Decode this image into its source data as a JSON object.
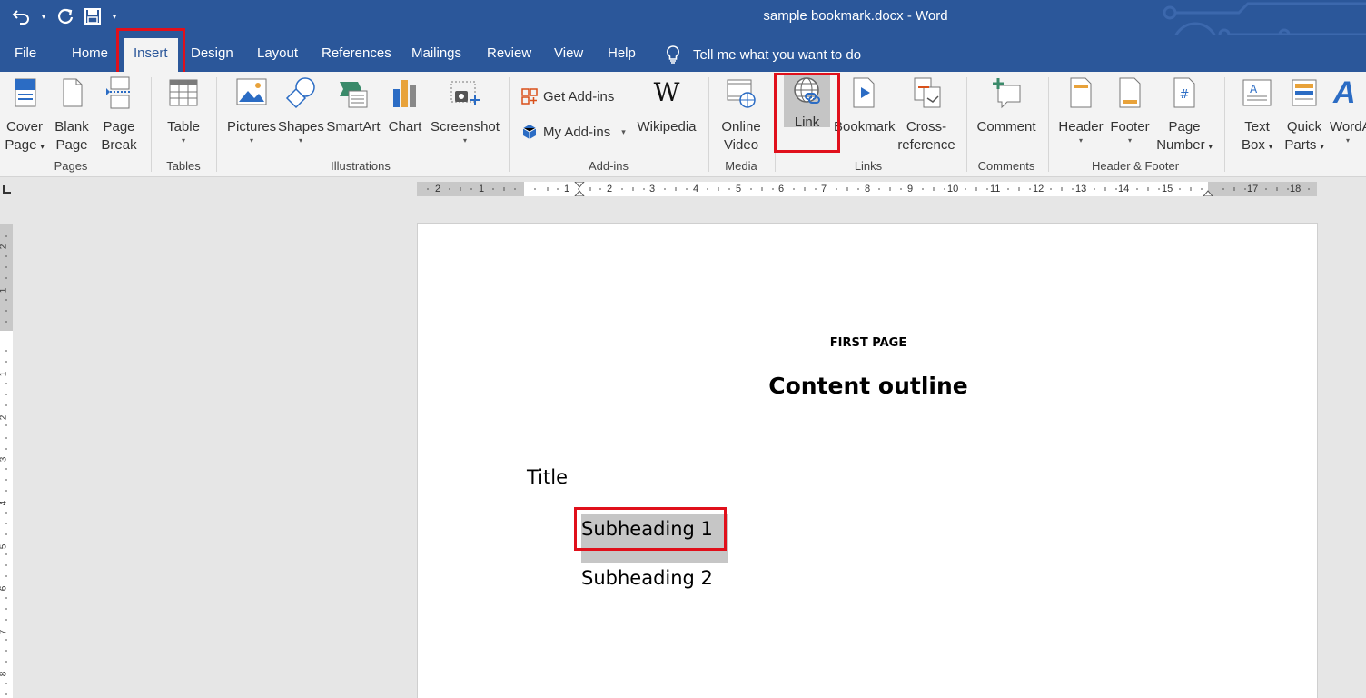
{
  "titlebar": {
    "document_title": "sample bookmark.docx  -  Word",
    "qat": {
      "undo_icon": "undo-icon",
      "redo_icon": "redo-icon",
      "save_icon": "save-icon",
      "customize_icon": "customize-qat-icon"
    }
  },
  "tabs": [
    {
      "label": "File"
    },
    {
      "label": "Home"
    },
    {
      "label": "Insert"
    },
    {
      "label": "Design"
    },
    {
      "label": "Layout"
    },
    {
      "label": "References"
    },
    {
      "label": "Mailings"
    },
    {
      "label": "Review"
    },
    {
      "label": "View"
    },
    {
      "label": "Help"
    }
  ],
  "tell_me": "Tell me what you want to do",
  "ribbon": {
    "pages": {
      "label": "Pages",
      "cover_line1": "Cover",
      "cover_line2": "Page",
      "blank_line1": "Blank",
      "blank_line2": "Page",
      "break_line1": "Page",
      "break_line2": "Break"
    },
    "tables": {
      "label": "Tables",
      "table": "Table"
    },
    "illustrations": {
      "label": "Illustrations",
      "pictures": "Pictures",
      "shapes": "Shapes",
      "smartart": "SmartArt",
      "chart": "Chart",
      "screenshot": "Screenshot"
    },
    "addins": {
      "label": "Add-ins",
      "get": "Get Add-ins",
      "my": "My Add-ins",
      "wikipedia": "Wikipedia",
      "wiki_glyph": "W"
    },
    "media": {
      "label": "Media",
      "line1": "Online",
      "line2": "Video"
    },
    "links": {
      "label": "Links",
      "link": "Link",
      "bookmark": "Bookmark",
      "cross_line1": "Cross-",
      "cross_line2": "reference"
    },
    "comments": {
      "label": "Comments",
      "comment": "Comment"
    },
    "header_footer": {
      "label": "Header & Footer",
      "header": "Header",
      "footer": "Footer",
      "pagenum_line1": "Page",
      "pagenum_line2": "Number"
    },
    "text": {
      "textbox_line1": "Text",
      "textbox_line2": "Box",
      "quick_line1": "Quick",
      "quick_line2": "Parts",
      "wordart": "WordA"
    }
  },
  "hruler_ticks": [
    "2",
    "1",
    "1",
    "2",
    "3",
    "4",
    "5",
    "6",
    "7",
    "8",
    "9",
    "10",
    "11",
    "12",
    "13",
    "14",
    "15",
    "17",
    "18"
  ],
  "vruler_ticks": [
    "2",
    "1",
    "1",
    "2",
    "3",
    "4",
    "5",
    "6",
    "7",
    "8"
  ],
  "document": {
    "first_page": "FIRST PAGE",
    "heading": "Content outline",
    "title": "Title",
    "subheading1": "Subheading 1",
    "subheading2": "Subheading 2"
  },
  "colors": {
    "accent": "#2b579a",
    "highlight": "#e0101b"
  }
}
